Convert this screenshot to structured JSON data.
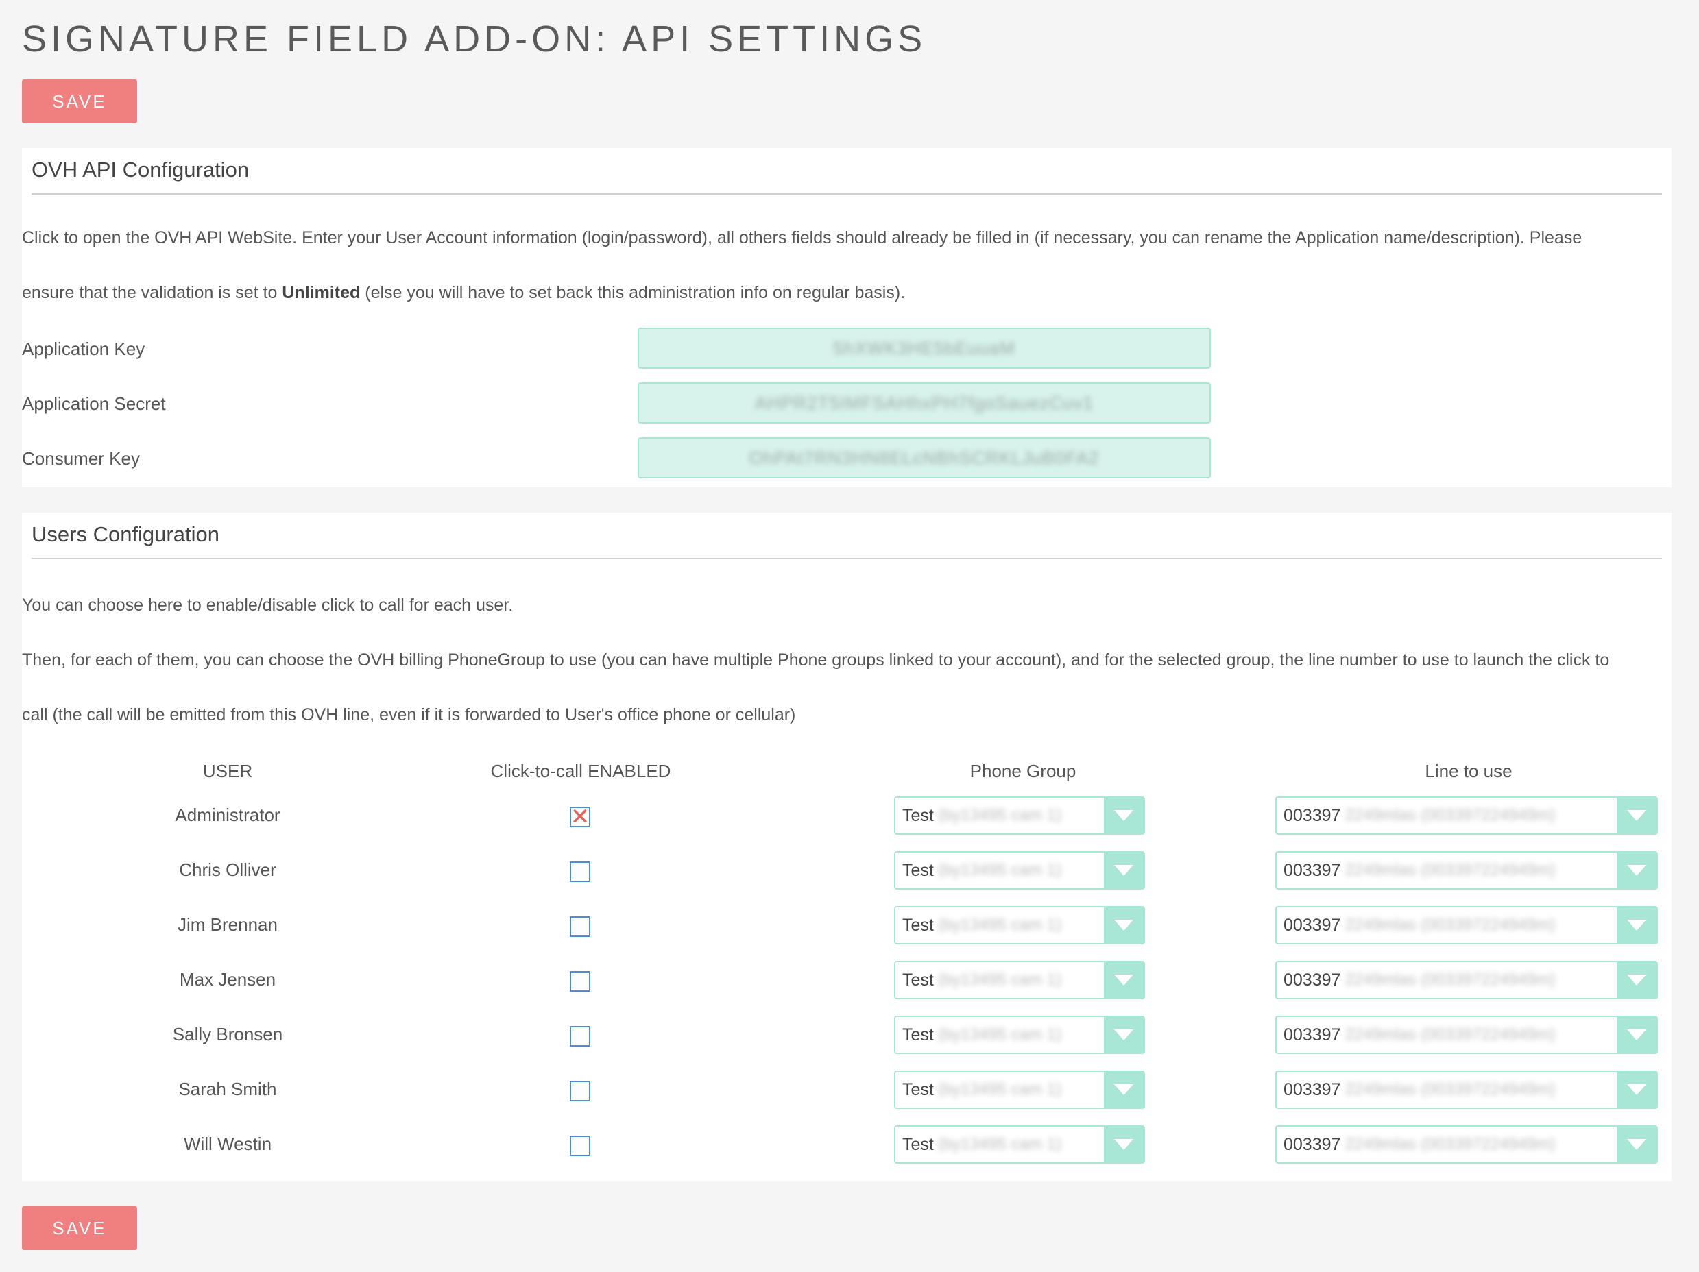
{
  "page": {
    "title": "Signature Field Add-On: API Settings",
    "save_label": "SAVE"
  },
  "colors": {
    "accent_button": "#f08080",
    "input_bg": "#d8f2ec",
    "input_border": "#a8e6d6",
    "checkbox_border": "#4a8fd6",
    "check_mark": "#e8605a"
  },
  "api_config": {
    "heading": "OVH API Configuration",
    "desc_line1": "Click to open the OVH API WebSite. Enter your User Account information (login/password), all others fields should already be filled in (if necessary, you can rename the Application name/description). Please",
    "desc_line2_pre": "ensure that the validation is set to ",
    "desc_line2_bold": "Unlimited",
    "desc_line2_post": " (else you will have to set back this administration info on regular basis).",
    "fields": [
      {
        "label": "Application Key",
        "value": "5hXWK3HE5bEuuaM"
      },
      {
        "label": "Application Secret",
        "value": "AHPR2T5IMFSAHhxPH7fgoSauezCuv1"
      },
      {
        "label": "Consumer Key",
        "value": "OhPAt7RN3HN8ELcNBhSCRKLJuB0FA2"
      }
    ]
  },
  "users_config": {
    "heading": "Users Configuration",
    "desc_line1": "You can choose here to enable/disable click to call for each user.",
    "desc_line2": "Then, for each of them, you can choose the OVH billing PhoneGroup to use (you can have multiple Phone groups linked to your account), and for the selected group, the line number to use to launch the click to",
    "desc_line3": "call (the call will be emitted from this OVH line, even if it is forwarded to User's office phone or cellular)",
    "columns": [
      "USER",
      "Click-to-call ENABLED",
      "Phone Group",
      "Line to use"
    ],
    "rows": [
      {
        "user": "Administrator",
        "enabled": true,
        "group": "Test",
        "group_hidden": "(by13495 cam 1)",
        "line": "003397",
        "line_hidden": "2249mlas (003397224949m)"
      },
      {
        "user": "Chris Olliver",
        "enabled": false,
        "group": "Test",
        "group_hidden": "(by13495 cam 1)",
        "line": "003397",
        "line_hidden": "2249mlas (003397224949m)"
      },
      {
        "user": "Jim Brennan",
        "enabled": false,
        "group": "Test",
        "group_hidden": "(by13495 cam 1)",
        "line": "003397",
        "line_hidden": "2249mlas (003397224949m)"
      },
      {
        "user": "Max Jensen",
        "enabled": false,
        "group": "Test",
        "group_hidden": "(by13495 cam 1)",
        "line": "003397",
        "line_hidden": "2249mlas (003397224949m)"
      },
      {
        "user": "Sally Bronsen",
        "enabled": false,
        "group": "Test",
        "group_hidden": "(by13495 cam 1)",
        "line": "003397",
        "line_hidden": "2249mlas (003397224949m)"
      },
      {
        "user": "Sarah Smith",
        "enabled": false,
        "group": "Test",
        "group_hidden": "(by13495 cam 1)",
        "line": "003397",
        "line_hidden": "2249mlas (003397224949m)"
      },
      {
        "user": "Will Westin",
        "enabled": false,
        "group": "Test",
        "group_hidden": "(by13495 cam 1)",
        "line": "003397",
        "line_hidden": "2249mlas (003397224949m)"
      }
    ]
  }
}
